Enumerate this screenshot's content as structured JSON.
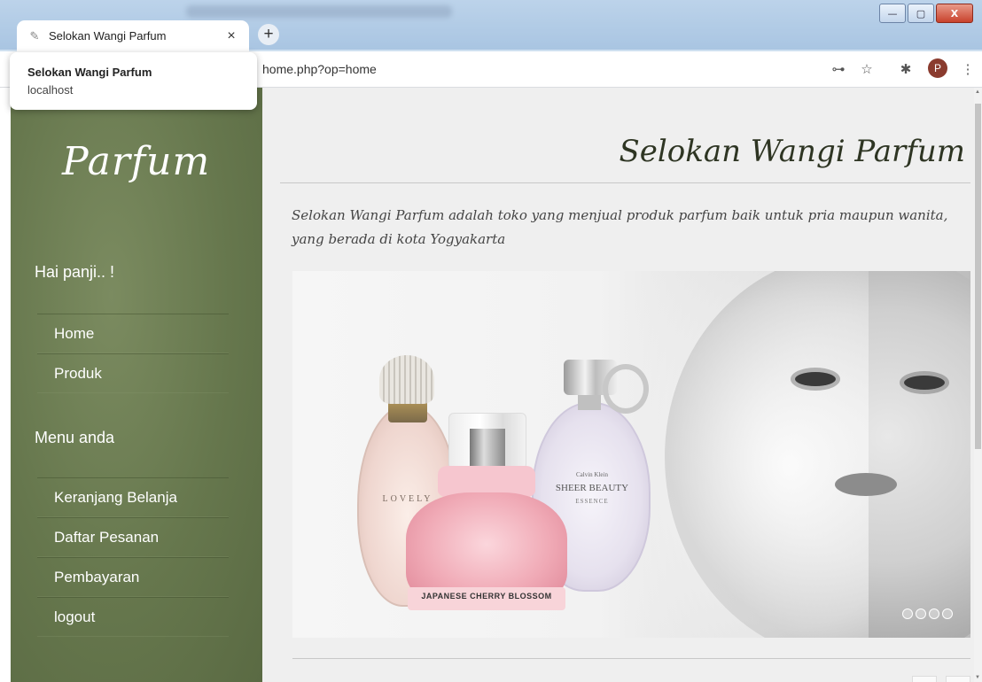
{
  "browser": {
    "tab_title": "Selokan Wangi Parfum",
    "tab_close": "×",
    "new_tab": "+",
    "url_visible": "home.php?op=home",
    "profile_initial": "P",
    "hovercard": {
      "title": "Selokan Wangi Parfum",
      "host": "localhost"
    },
    "window_buttons": {
      "minimize": "—",
      "maximize": "▢",
      "close": "X"
    }
  },
  "sidebar": {
    "logo": "Parfum",
    "greeting": "Hai panji.. !",
    "main_nav": [
      {
        "label": "Home"
      },
      {
        "label": "Produk"
      }
    ],
    "menu_heading": "Menu anda",
    "user_nav": [
      {
        "label": "Keranjang Belanja"
      },
      {
        "label": "Daftar Pesanan"
      },
      {
        "label": "Pembayaran"
      },
      {
        "label": "logout"
      }
    ]
  },
  "main": {
    "site_title": "Selokan Wangi Parfum",
    "description": "Selokan Wangi Parfum adalah toko yang menjual produk parfum baik untuk pria maupun wanita, yang berada di kota Yogyakarta",
    "slider": {
      "slide_count": 4,
      "bottle_texts": {
        "lovely": "LOVELY",
        "brand": "Calvin Klein",
        "name": "SHEER BEAUTY",
        "sub": "ESSENCE",
        "pink": "JAPANESE CHERRY BLOSSOM"
      }
    }
  },
  "colors": {
    "sidebar_bg": "#66774d",
    "content_bg": "#efefef",
    "title_text": "#2e3523"
  }
}
